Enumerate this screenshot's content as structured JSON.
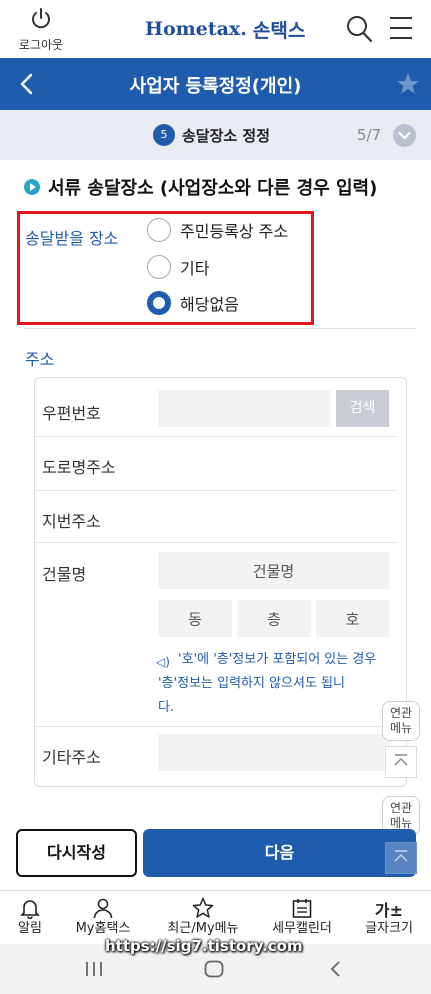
{
  "header": {
    "logout_label": "로그아웃",
    "logo_home": "Hometax.",
    "logo_son": "손택스"
  },
  "titlebar": {
    "title": "사업자 등록정정(개인)"
  },
  "step": {
    "number": "5",
    "name": "송달장소 정정",
    "pager": "5/7"
  },
  "section": {
    "title": "서류 송달장소 (사업장소와 다른 경우 입력)"
  },
  "delivery": {
    "label": "송달받을 장소",
    "options": [
      {
        "label": "주민등록상 주소",
        "selected": false
      },
      {
        "label": "기타",
        "selected": false
      },
      {
        "label": "해당없음",
        "selected": true
      }
    ]
  },
  "address": {
    "label": "주소",
    "zip_label": "우편번호",
    "search_label": "검색",
    "road_label": "도로명주소",
    "lot_label": "지번주소",
    "building_label": "건물명",
    "building_placeholder": "건물명",
    "dong_placeholder": "동",
    "floor_placeholder": "층",
    "ho_placeholder": "호",
    "notice_line1": "'호'에 '층'정보가 포함되어 있는 경우",
    "notice_line2": "'층'정보는 입력하지 않으셔도 됩니",
    "notice_line3": "다.",
    "other_label": "기타주소"
  },
  "side": {
    "related_menu_1": "연관",
    "related_menu_2": "메뉴"
  },
  "actions": {
    "reset_label": "다시작성",
    "next_label": "다음"
  },
  "tabs": [
    {
      "label": "알림",
      "icon": "bell-icon"
    },
    {
      "label": "My홈택스",
      "icon": "person-icon"
    },
    {
      "label": "최근/My메뉴",
      "icon": "star-icon"
    },
    {
      "label": "세무캘린더",
      "icon": "calendar-icon"
    },
    {
      "label": "글자크기",
      "icon": "font-size-icon"
    }
  ],
  "font_size_glyph": "가±",
  "watermark": "https://sig7.tistory.com",
  "colors": {
    "brand_blue": "#1f5cae",
    "highlight_red": "#e3161c",
    "step_bg": "#e9ecf2"
  }
}
